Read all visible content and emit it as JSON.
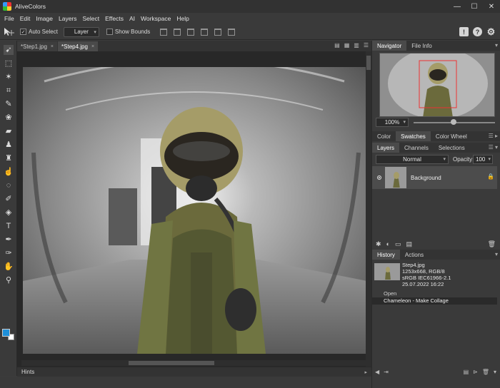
{
  "app": {
    "title": "AliveColors"
  },
  "window_buttons": {
    "minimize": "—",
    "maximize": "☐",
    "close": "✕"
  },
  "menu": [
    "File",
    "Edit",
    "Image",
    "Layers",
    "Select",
    "Effects",
    "AI",
    "Workspace",
    "Help"
  ],
  "options": {
    "auto_select_label": "Auto Select",
    "auto_select_checked": "✓",
    "layer_mode": "Layer",
    "show_bounds_label": "Show Bounds"
  },
  "header_icons": {
    "notice": "!",
    "help": "?",
    "settings": "⚙"
  },
  "doc_tabs": [
    {
      "label": "*Step1.jpg",
      "active": false
    },
    {
      "label": "*Step4.jpg",
      "active": true
    }
  ],
  "tab_close": "×",
  "navigator": {
    "tabs": [
      "Navigator",
      "File Info"
    ],
    "zoom": "100%"
  },
  "color_tabs": [
    "Color",
    "Swatches",
    "Color Wheel"
  ],
  "layers_panel": {
    "tabs": [
      "Layers",
      "Channels",
      "Selections"
    ],
    "blend_mode": "Normal",
    "opacity_label": "Opacity:",
    "opacity_value": "100",
    "layers": [
      {
        "name": "Background"
      }
    ]
  },
  "history_panel": {
    "tabs": [
      "History",
      "Actions"
    ],
    "file_name": "Step4.jpg",
    "file_size": "1253x668, RGB/8",
    "color_profile": "sRGB IEC61966-2.1",
    "date": "25.07.2022 16:22",
    "steps": [
      "Open",
      "Chameleon - Make Collage"
    ]
  },
  "hints": {
    "label": "Hints"
  },
  "colors": {
    "foreground": "#1e8fd8",
    "background": "#ffffff",
    "ui_bg": "#3a3a3a"
  }
}
